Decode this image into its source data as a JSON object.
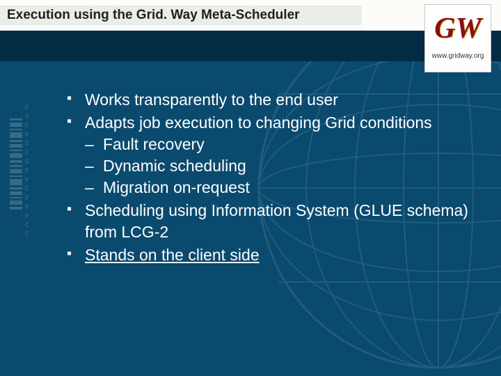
{
  "title": "Execution using the Grid. Way Meta-Scheduler",
  "logo": {
    "mono": "GW",
    "url": "www.gridway.org"
  },
  "barcode_digits": "324442445304354",
  "bullets": {
    "b1": "Works transparently to the end user",
    "b2": "Adapts job execution to changing Grid conditions",
    "b2s1": "Fault recovery",
    "b2s2": "Dynamic scheduling",
    "b2s3": "Migration on-request",
    "b3": "Scheduling using Information System (GLUE schema) from LCG-2",
    "b4": "Stands on the client side"
  }
}
